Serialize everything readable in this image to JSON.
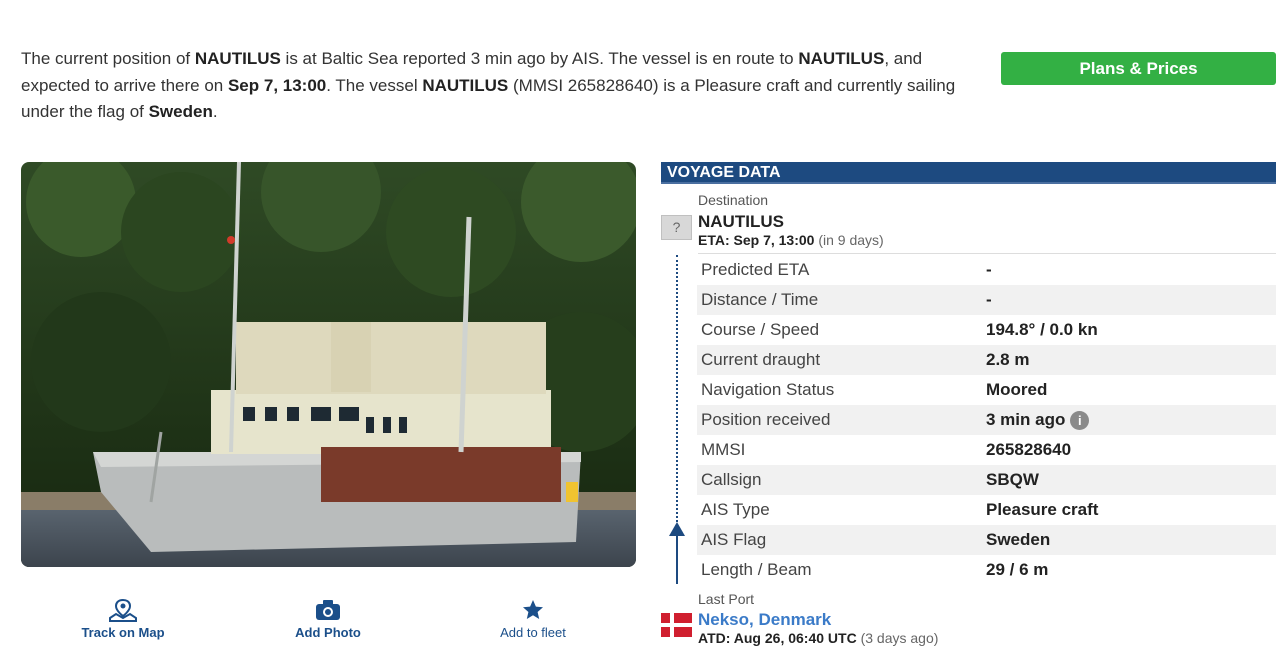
{
  "intro": {
    "p1": "The current position of ",
    "vessel1": "NAUTILUS",
    "p2": " is at Baltic Sea reported 3 min ago by AIS. The vessel is en route to ",
    "vessel2": "NAUTILUS",
    "p3": ", and expected to arrive there on ",
    "eta": "Sep 7, 13:00",
    "p4": ". The vessel ",
    "vessel3": "NAUTILUS",
    "p5": " (MMSI 265828640) is a Pleasure craft and currently sailing under the flag of ",
    "flag": "Sweden",
    "p6": "."
  },
  "plans_button": "Plans & Prices",
  "actions": {
    "track": "Track on Map",
    "photo": "Add Photo",
    "fleet": "Add to fleet"
  },
  "voyage": {
    "header": "VOYAGE DATA",
    "destination_label": "Destination",
    "destination_badge": "?",
    "destination_name": "NAUTILUS",
    "eta_label": "ETA: Sep 7, 13:00",
    "eta_relative": "(in 9 days)",
    "rows": [
      {
        "key": "Predicted ETA",
        "value": "-"
      },
      {
        "key": "Distance / Time",
        "value": "-"
      },
      {
        "key": "Course / Speed",
        "value": "194.8° / 0.0 kn"
      },
      {
        "key": "Current draught",
        "value": "2.8 m"
      },
      {
        "key": "Navigation Status",
        "value": "Moored"
      },
      {
        "key": "Position received",
        "value": "3 min ago"
      },
      {
        "key": "MMSI",
        "value": "265828640"
      },
      {
        "key": "Callsign",
        "value": "SBQW"
      },
      {
        "key": "AIS Type",
        "value": "Pleasure craft"
      },
      {
        "key": "AIS Flag",
        "value": "Sweden"
      },
      {
        "key": "Length / Beam",
        "value": "29 / 6 m"
      }
    ],
    "info_icon": "i",
    "last_port_label": "Last Port",
    "last_port_name": "Nekso, Denmark",
    "atd_label": "ATD: Aug 26, 06:40 UTC",
    "atd_relative": "(3 days ago)"
  },
  "colors": {
    "header_bg": "#1d4a80",
    "button_green": "#33b044",
    "link_blue": "#3b7bc8"
  }
}
